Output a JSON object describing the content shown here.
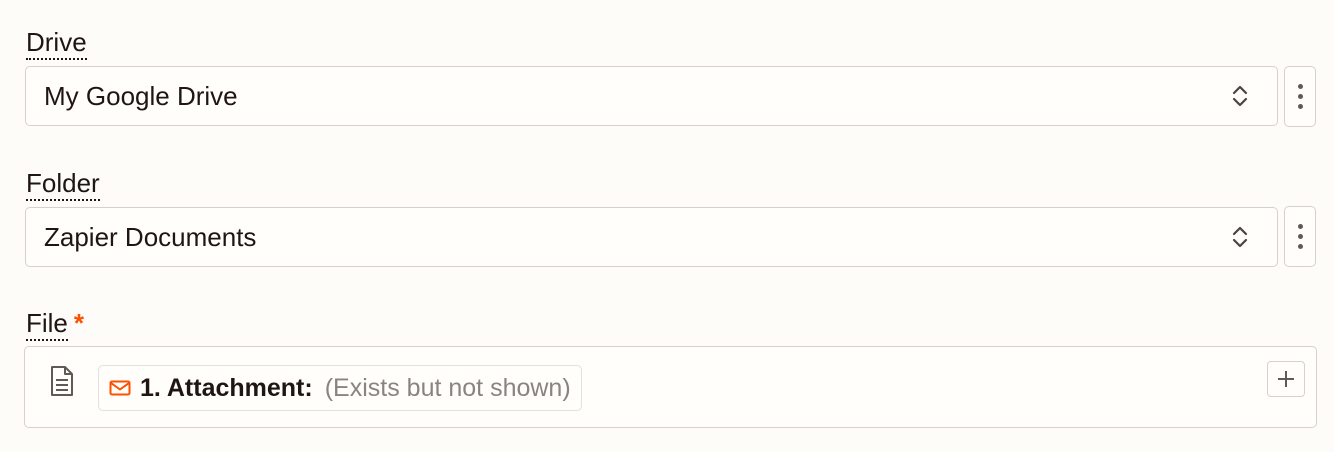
{
  "drive_field": {
    "label": "Drive",
    "value": "My Google Drive",
    "control_icon": "chevron-up-down-icon",
    "more_icon": "vertical-ellipsis-icon"
  },
  "folder_field": {
    "label": "Folder",
    "value": "Zapier Documents",
    "control_icon": "chevron-up-down-icon",
    "more_icon": "vertical-ellipsis-icon"
  },
  "file_field": {
    "label": "File",
    "required_marker": "*",
    "field_icon": "document-icon",
    "mapped_value": {
      "source_icon": "mail-icon",
      "label": "1. Attachment:",
      "value": "(Exists but not shown)"
    },
    "add_icon": "plus-icon"
  },
  "colors": {
    "background": "#fdfcf8",
    "border": "#d6d2c9",
    "accent": "#ff4f00",
    "text": "#201515",
    "muted_text": "#8a8480"
  }
}
